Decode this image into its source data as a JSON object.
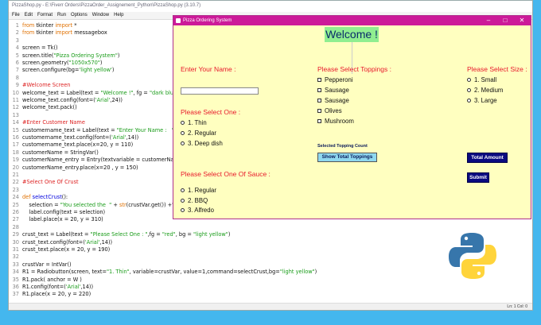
{
  "editor": {
    "title": "PizzaShop.py - E:\\Fiverr Orders\\PizzaOrder_Assignement_Python\\PizzaShop.py (3.10.7)",
    "menu": [
      "File",
      "Edit",
      "Format",
      "Run",
      "Options",
      "Window",
      "Help"
    ],
    "status": "Ln: 1   Col: 0",
    "lines": [
      {
        "n": "1",
        "tokens": [
          {
            "t": "from ",
            "c": "kw"
          },
          {
            "t": "tkinter ",
            "c": "nm"
          },
          {
            "t": "import",
            "c": "kw"
          },
          {
            "t": " *",
            "c": "nm"
          }
        ]
      },
      {
        "n": "2",
        "tokens": [
          {
            "t": "from ",
            "c": "kw"
          },
          {
            "t": "tkinter ",
            "c": "nm"
          },
          {
            "t": "import",
            "c": "kw"
          },
          {
            "t": " messagebox",
            "c": "nm"
          }
        ]
      },
      {
        "n": "3",
        "tokens": []
      },
      {
        "n": "4",
        "tokens": [
          {
            "t": "screen = Tk()",
            "c": "nm"
          }
        ]
      },
      {
        "n": "5",
        "tokens": [
          {
            "t": "screen.title(",
            "c": "nm"
          },
          {
            "t": "\"Pizza Ordering System\"",
            "c": "str"
          },
          {
            "t": ")",
            "c": "nm"
          }
        ]
      },
      {
        "n": "6",
        "tokens": [
          {
            "t": "screen.geometry(",
            "c": "nm"
          },
          {
            "t": "\"1050x570\"",
            "c": "str"
          },
          {
            "t": ")",
            "c": "nm"
          }
        ]
      },
      {
        "n": "7",
        "tokens": [
          {
            "t": "screen.configure(bg=",
            "c": "nm"
          },
          {
            "t": "'light yellow'",
            "c": "str"
          },
          {
            "t": ")",
            "c": "nm"
          }
        ]
      },
      {
        "n": "8",
        "tokens": []
      },
      {
        "n": "9",
        "tokens": [
          {
            "t": "#Welcome Screen",
            "c": "cm"
          }
        ]
      },
      {
        "n": "10",
        "tokens": [
          {
            "t": "welcome_text = Label(text = ",
            "c": "nm"
          },
          {
            "t": "\"Welcome !\"",
            "c": "str"
          },
          {
            "t": ", fg = ",
            "c": "nm"
          },
          {
            "t": "\"dark blue\"",
            "c": "str"
          }
        ]
      },
      {
        "n": "11",
        "tokens": [
          {
            "t": "welcome_text.config(font=(",
            "c": "nm"
          },
          {
            "t": "'Arial'",
            "c": "str"
          },
          {
            "t": ",24))",
            "c": "nm"
          }
        ]
      },
      {
        "n": "12",
        "tokens": [
          {
            "t": "welcome_text.pack()",
            "c": "nm"
          }
        ]
      },
      {
        "n": "13",
        "tokens": []
      },
      {
        "n": "14",
        "tokens": [
          {
            "t": "#Enter Customer Name",
            "c": "cm"
          }
        ]
      },
      {
        "n": "15",
        "tokens": [
          {
            "t": "customername_text = Label(text = ",
            "c": "nm"
          },
          {
            "t": "\"Enter Your Name :   \"",
            "c": "str"
          }
        ]
      },
      {
        "n": "16",
        "tokens": [
          {
            "t": "customername_text.config(font=(",
            "c": "nm"
          },
          {
            "t": "'Arial'",
            "c": "str"
          },
          {
            "t": ",14))",
            "c": "nm"
          }
        ]
      },
      {
        "n": "17",
        "tokens": [
          {
            "t": "customername_text.place(x=20, y = 110)",
            "c": "nm"
          }
        ]
      },
      {
        "n": "18",
        "tokens": [
          {
            "t": "customerName = StringVar()",
            "c": "nm"
          }
        ]
      },
      {
        "n": "19",
        "tokens": [
          {
            "t": "customerName_entry = Entry(textvariable = customerNa",
            "c": "nm"
          }
        ]
      },
      {
        "n": "20",
        "tokens": [
          {
            "t": "customerName_entry.place(x=20 , y = 150)",
            "c": "nm"
          }
        ]
      },
      {
        "n": "21",
        "tokens": []
      },
      {
        "n": "22",
        "tokens": [
          {
            "t": "#Select One Of Crust",
            "c": "cm"
          }
        ]
      },
      {
        "n": "23",
        "tokens": []
      },
      {
        "n": "24",
        "tokens": [
          {
            "t": "def ",
            "c": "kw"
          },
          {
            "t": "selectCrust",
            "c": "fn"
          },
          {
            "t": "():",
            "c": "nm"
          }
        ]
      },
      {
        "n": "25",
        "tokens": [
          {
            "t": "    selection = ",
            "c": "nm"
          },
          {
            "t": "\"You selected the  \"",
            "c": "str"
          },
          {
            "t": " + ",
            "c": "nm"
          },
          {
            "t": "str",
            "c": "kw"
          },
          {
            "t": "(crustVar.get()) +\"",
            "c": "nm"
          }
        ]
      },
      {
        "n": "26",
        "tokens": [
          {
            "t": "    label.config(text = selection)",
            "c": "nm"
          }
        ]
      },
      {
        "n": "27",
        "tokens": [
          {
            "t": "    label.place(x = 20, y = 310)",
            "c": "nm"
          }
        ]
      },
      {
        "n": "28",
        "tokens": []
      },
      {
        "n": "29",
        "tokens": [
          {
            "t": "crust_text = Label(text = ",
            "c": "nm"
          },
          {
            "t": "\"Please Select One : \"",
            "c": "str"
          },
          {
            "t": ",fg = ",
            "c": "nm"
          },
          {
            "t": "\"red\"",
            "c": "str"
          },
          {
            "t": ", bg = ",
            "c": "nm"
          },
          {
            "t": "\"light yellow\"",
            "c": "str"
          },
          {
            "t": ")",
            "c": "nm"
          }
        ]
      },
      {
        "n": "30",
        "tokens": [
          {
            "t": "crust_text.config(font=(",
            "c": "nm"
          },
          {
            "t": "'Arial'",
            "c": "str"
          },
          {
            "t": ",14))",
            "c": "nm"
          }
        ]
      },
      {
        "n": "31",
        "tokens": [
          {
            "t": "crust_text.place(x = 20, y = 190)",
            "c": "nm"
          }
        ]
      },
      {
        "n": "32",
        "tokens": []
      },
      {
        "n": "33",
        "tokens": [
          {
            "t": "crustVar = IntVar()",
            "c": "nm"
          }
        ]
      },
      {
        "n": "34",
        "tokens": [
          {
            "t": "R1 = Radiobutton(screen, text=",
            "c": "nm"
          },
          {
            "t": "\"1. Thin\"",
            "c": "str"
          },
          {
            "t": ", variable=crustVar, value=1,command=selectCrust,bg=",
            "c": "nm"
          },
          {
            "t": "\"light yellow\"",
            "c": "str"
          },
          {
            "t": ")",
            "c": "nm"
          }
        ]
      },
      {
        "n": "35",
        "tokens": [
          {
            "t": "R1.pack( anchor = W )",
            "c": "nm"
          }
        ]
      },
      {
        "n": "36",
        "tokens": [
          {
            "t": "R1.config(font=(",
            "c": "nm"
          },
          {
            "t": "'Arial'",
            "c": "str"
          },
          {
            "t": ",14))",
            "c": "nm"
          }
        ]
      },
      {
        "n": "37",
        "tokens": [
          {
            "t": "R1.place(x = 20, y = 220)",
            "c": "nm"
          }
        ]
      }
    ]
  },
  "app": {
    "title": "Pizza Ordering System",
    "window_buttons": {
      "minimize": "–",
      "maximize": "□",
      "close": "✕"
    },
    "welcome": "Welcome !",
    "name_label": "Enter Your Name :",
    "name_value": "",
    "crust_label": "Please Select One :",
    "crust_options": [
      "1. Thin",
      "2. Regular",
      "3. Deep dish"
    ],
    "sauce_label": "Please Select One Of Sauce :",
    "sauce_options": [
      "1. Regular",
      "2. BBQ",
      "3. Alfredo"
    ],
    "toppings_label": "Please Select Toppings :",
    "toppings": [
      "Pepperoni",
      "Sausage",
      "Sausage",
      "Olives",
      "Mushroom"
    ],
    "topping_count_label": "Selected Topping Count",
    "show_total_button": "Show Total Toppings",
    "size_label": "Please Select Size :",
    "size_options": [
      "1. Small",
      "2. Medium",
      "3. Large"
    ],
    "total_button": "Total Amount",
    "submit_button": "Submit"
  },
  "colors": {
    "accent_red": "#e8192c",
    "titlebar": "#cc1a99",
    "app_bg": "#ffffc0",
    "desktop": "#44b7ee"
  },
  "logo_icon": "python-logo-icon"
}
